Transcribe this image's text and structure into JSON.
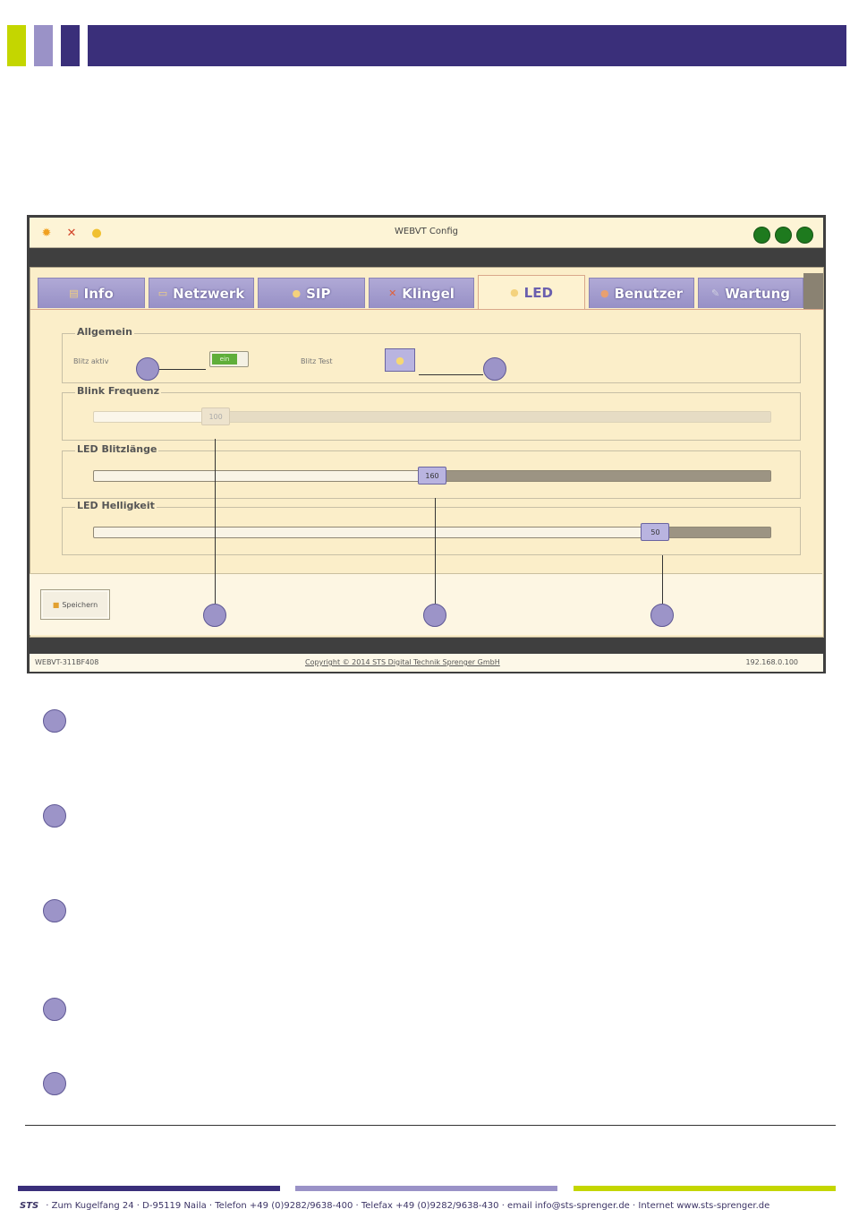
{
  "colors": {
    "lime": "#c4d600",
    "lavender": "#9a92c7",
    "navy": "#3a2f7a"
  },
  "window": {
    "title": "WEBVT Config",
    "tabs": [
      {
        "label": "Info",
        "icon": "info-icon"
      },
      {
        "label": "Netzwerk",
        "icon": "network-icon"
      },
      {
        "label": "SIP",
        "icon": "sip-icon"
      },
      {
        "label": "Klingel",
        "icon": "bell-icon"
      },
      {
        "label": "LED",
        "icon": "bulb-icon",
        "active": true
      },
      {
        "label": "Benutzer",
        "icon": "user-icon"
      },
      {
        "label": "Wartung",
        "icon": "wrench-icon"
      }
    ],
    "groups": {
      "allgemein": {
        "legend": "Allgemein",
        "blitz_label": "Blitz aktiv",
        "toggle_text": "ein",
        "test_label": "Blitz Test"
      },
      "blink": {
        "legend": "Blink Frequenz",
        "value": "100",
        "fraction": 0.18,
        "disabled": true
      },
      "blitzlaenge": {
        "legend": "LED Blitzlänge",
        "value": "160",
        "fraction": 0.5
      },
      "helligkeit": {
        "legend": "LED Helligkeit",
        "value": "50",
        "fraction": 0.83
      }
    },
    "save_label": "Speichern",
    "status": {
      "left": "WEBVT-311BF408",
      "center": "Copyright © 2014 STS Digital Technik Sprenger GmbH",
      "right": "192.168.0.100"
    }
  },
  "footer": {
    "brand": "STS",
    "address": "· Zum Kugelfang 24 · D-95119 Naila · Telefon +49 (0)9282/9638-400 · Telefax +49 (0)9282/9638-430 · email  info@sts-sprenger.de · Internet  www.sts-sprenger.de"
  }
}
